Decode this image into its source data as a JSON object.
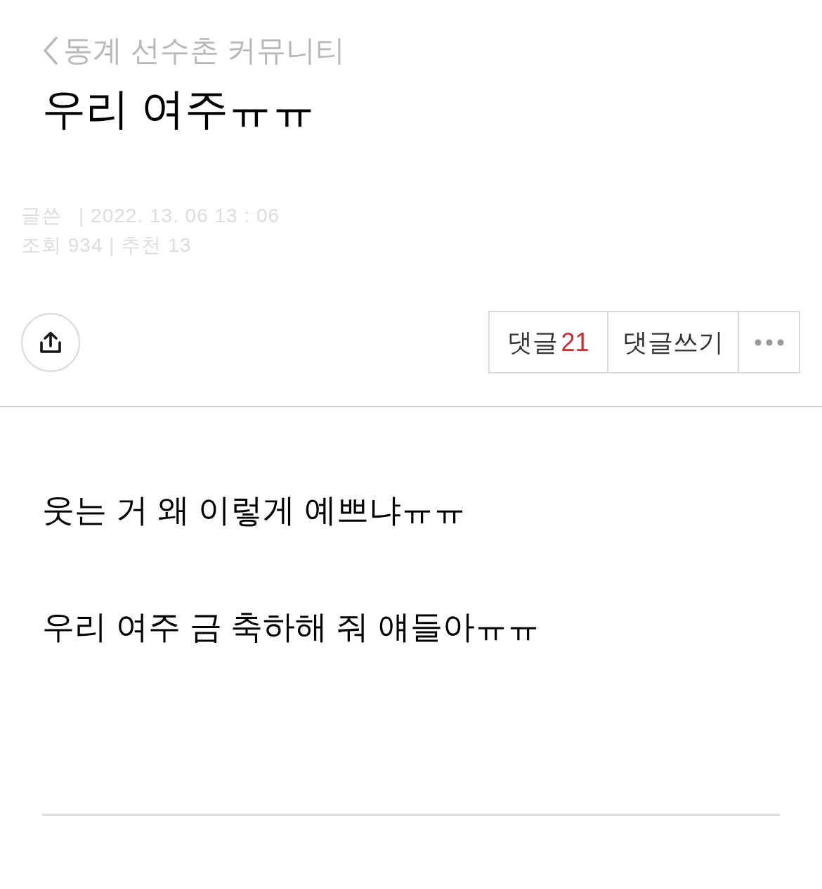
{
  "breadcrumb": {
    "label": "동계 선수촌 커뮤니티"
  },
  "title": "우리 여주ㅠㅠ",
  "meta_lines": [
    [
      "글쓴",
      "| 2022. 13. 06 13 : 06"
    ],
    [
      "조회 934 | 추천 13"
    ]
  ],
  "actions": {
    "comments": {
      "label": "댓글",
      "count": "21"
    },
    "write_comment": "댓글쓰기"
  },
  "body": [
    "웃는 거 왜 이렇게 예쁘냐ㅠㅠ",
    "우리 여주 금 축하해 줘 얘들아ㅠㅠ"
  ]
}
